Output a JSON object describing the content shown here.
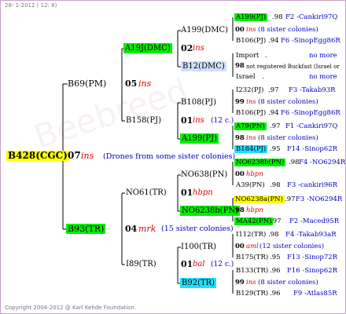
{
  "header": "28- 1-2012 ( 12: 8)",
  "footer": "Copyright 2004-2012 @ Karl Kehde Foundation.",
  "root": {
    "id": "B428(CGC)",
    "num": "07",
    "type": "ins",
    "note": "(Drones from some sister colonies)"
  },
  "g1": [
    {
      "id": "B69(PM)",
      "num": "05",
      "type": "ins"
    },
    {
      "id": "B93(TR)",
      "num": "04",
      "type": "mrk",
      "note": "(15 sister colonies)"
    }
  ],
  "g2": [
    {
      "id": "A19J(DMC)",
      "num": "02",
      "type": "ins"
    },
    {
      "id": "B158(PJ)",
      "num": "01",
      "type": "ins",
      "note": "(12 c.)"
    },
    {
      "id": "NO61(TR)",
      "num": "01",
      "type": "hbpn"
    },
    {
      "id": "I89(TR)",
      "num": "01",
      "type": "bal",
      "note": "(12 c.)"
    }
  ],
  "g3": [
    {
      "id": "A199(DMC)",
      "num": "00",
      "type": "ins",
      "note": "(8 sister colonies)"
    },
    {
      "id": "B12(DMC)",
      "num": "98",
      "note": "not registered Buckfast (Israel or"
    },
    {
      "id": "B108(PJ)",
      "num": "99",
      "type": "ins",
      "note": "(8 sister colonies)"
    },
    {
      "id": "A199(PJ)",
      "num": "98",
      "type": "ins",
      "note": "(8 sister colonies)"
    },
    {
      "id": "NO638(PN)",
      "num": "00",
      "type": "hbpn"
    },
    {
      "id": "NO6238b(PN)",
      "num": "98",
      "type": "hbpn"
    },
    {
      "id": "I100(TR)",
      "num": "00",
      "type": "aml",
      "note": "(12 sister colonies)"
    },
    {
      "id": "B92(TR)",
      "num": "99",
      "type": "ins",
      "note": "(8 sister colonies)"
    }
  ],
  "g4": [
    {
      "id": "A199(PJ)",
      "yr": ".98",
      "loc": "F2 -Cankiri97Q"
    },
    {
      "id": "B106(PJ)",
      "yr": ".94",
      "loc": "F6 -SinopEgg86R"
    },
    {
      "id": "Import",
      "yr": ".",
      "loc": "no more"
    },
    {
      "id": "Israel",
      "yr": ".",
      "loc": "no more"
    },
    {
      "id": "I232(PJ)",
      "yr": ".97",
      "loc": "F3 -Takab93R"
    },
    {
      "id": "B106(PJ)",
      "yr": ".94",
      "loc": "F6 -SinopEgg86R"
    },
    {
      "id": "A79(PN)",
      "yr": ".97",
      "loc": "F1 -Cankiri97Q"
    },
    {
      "id": "B184(PJ)",
      "yr": ".95",
      "loc": "F14 -Sinop62R"
    },
    {
      "id": "NO6238b(PN)",
      "yr": ".98",
      "loc": "F4 -NO6294R"
    },
    {
      "id": "A39(PN)",
      "yr": ".98",
      "loc": "F3 -cankiri96R"
    },
    {
      "id": "NO6238a(PN)",
      "yr": ".97",
      "loc": "F3 -NO6294R"
    },
    {
      "id": "MA42(PN)",
      "yr": ".97",
      "loc": "F2 -Maced95R"
    },
    {
      "id": "I112(TR)",
      "yr": ".98",
      "loc": "F4 -Takab93aR"
    },
    {
      "id": "B175(TR)",
      "yr": ".95",
      "loc": "F13 -Sinop72R"
    },
    {
      "id": "B133(TR)",
      "yr": ".96",
      "loc": "F16 -Sinop62R"
    },
    {
      "id": "B129(TR)",
      "yr": ".96",
      "loc": "F9 -Atlas85R"
    }
  ]
}
